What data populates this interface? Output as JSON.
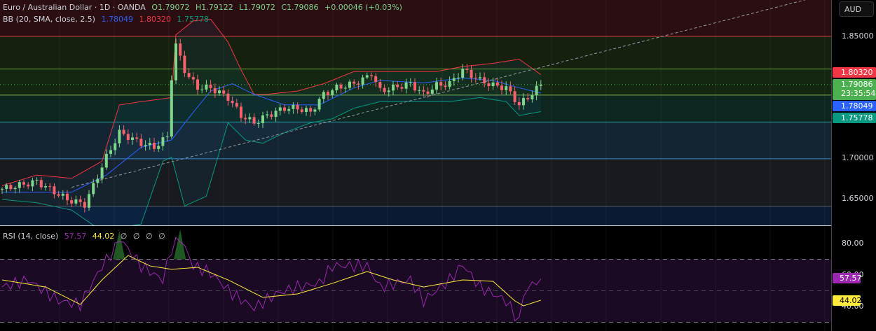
{
  "header": {
    "symbol": "Euro / Australian Dollar · 1D · OANDA",
    "open": "O1.79072",
    "high": "H1.79122",
    "low": "L1.79072",
    "close": "C1.79086",
    "change": "+0.00046 (+0.03%)"
  },
  "bb_legend": {
    "label": "BB (20, SMA, close, 2.5)",
    "basis": "1.78049",
    "upper": "1.80320",
    "lower": "1.75778"
  },
  "rsi_legend": {
    "label": "RSI (14, close)",
    "rsi": "57.57",
    "ma": "44.02",
    "extra": [
      "∅",
      "∅",
      "∅",
      "∅"
    ]
  },
  "axis": {
    "currency": "AUD",
    "price_ticks": [
      "1.85000",
      "1.70000",
      "1.65000"
    ],
    "rsi_ticks": [
      "80.00",
      "60.00",
      "40.00"
    ],
    "tags": {
      "upper": "1.80320",
      "last": "1.79086",
      "countdown": "23:35:54",
      "basis": "1.78049",
      "lower": "1.75778",
      "rsi": "57.57",
      "rsi_ma": "44.02"
    }
  },
  "colors": {
    "up": "#7fd68a",
    "down": "#f7606c",
    "basis": "#2962ff",
    "upper": "#f23645",
    "lower": "#089981",
    "rsi": "#9c27b0",
    "rsi_ma": "#ffeb3b"
  },
  "chart_data": {
    "type": "candlestick",
    "price_range": [
      1.6,
      1.895
    ],
    "levels": [
      1.85,
      1.81,
      1.778,
      1.745,
      1.7,
      1.6415
    ],
    "close_path": [
      [
        0,
        1.663
      ],
      [
        8,
        1.672
      ],
      [
        15,
        1.65
      ],
      [
        19,
        1.644
      ],
      [
        21,
        1.667
      ],
      [
        24,
        1.702
      ],
      [
        27,
        1.732
      ],
      [
        29,
        1.727
      ],
      [
        32,
        1.719
      ],
      [
        35,
        1.714
      ],
      [
        38,
        1.727
      ],
      [
        39,
        1.8
      ],
      [
        40,
        1.839
      ],
      [
        42,
        1.809
      ],
      [
        43,
        1.8
      ],
      [
        45,
        1.787
      ],
      [
        48,
        1.787
      ],
      [
        52,
        1.775
      ],
      [
        55,
        1.753
      ],
      [
        58,
        1.744
      ],
      [
        61,
        1.753
      ],
      [
        65,
        1.762
      ],
      [
        68,
        1.762
      ],
      [
        71,
        1.757
      ],
      [
        74,
        1.779
      ],
      [
        77,
        1.787
      ],
      [
        81,
        1.792
      ],
      [
        84,
        1.8
      ],
      [
        85,
        1.805
      ],
      [
        87,
        1.783
      ],
      [
        90,
        1.787
      ],
      [
        94,
        1.792
      ],
      [
        97,
        1.779
      ],
      [
        100,
        1.79
      ],
      [
        103,
        1.792
      ],
      [
        106,
        1.809
      ],
      [
        110,
        1.796
      ],
      [
        113,
        1.79
      ],
      [
        116,
        1.787
      ],
      [
        119,
        1.766
      ],
      [
        121,
        1.775
      ],
      [
        124,
        1.79086
      ]
    ],
    "bb_upper": [
      [
        0,
        1.667
      ],
      [
        8,
        1.68
      ],
      [
        16,
        1.676
      ],
      [
        23,
        1.697
      ],
      [
        27,
        1.766
      ],
      [
        32,
        1.77
      ],
      [
        39,
        1.775
      ],
      [
        40,
        1.852
      ],
      [
        44,
        1.869
      ],
      [
        48,
        1.871
      ],
      [
        52,
        1.843
      ],
      [
        55,
        1.809
      ],
      [
        58,
        1.779
      ],
      [
        61,
        1.779
      ],
      [
        68,
        1.783
      ],
      [
        74,
        1.792
      ],
      [
        81,
        1.807
      ],
      [
        100,
        1.807
      ],
      [
        106,
        1.813
      ],
      [
        113,
        1.817
      ],
      [
        119,
        1.822
      ],
      [
        124,
        1.8032
      ]
    ],
    "bb_lower": [
      [
        0,
        1.65
      ],
      [
        8,
        1.646
      ],
      [
        16,
        1.637
      ],
      [
        23,
        1.611
      ],
      [
        32,
        1.62
      ],
      [
        37,
        1.697
      ],
      [
        39,
        1.702
      ],
      [
        42,
        1.642
      ],
      [
        47,
        1.654
      ],
      [
        52,
        1.744
      ],
      [
        56,
        1.723
      ],
      [
        60,
        1.719
      ],
      [
        65,
        1.732
      ],
      [
        71,
        1.744
      ],
      [
        76,
        1.749
      ],
      [
        81,
        1.762
      ],
      [
        87,
        1.77
      ],
      [
        103,
        1.77
      ],
      [
        110,
        1.775
      ],
      [
        116,
        1.77
      ],
      [
        119,
        1.753
      ],
      [
        124,
        1.75778
      ]
    ],
    "bb_basis": [
      [
        0,
        1.659
      ],
      [
        16,
        1.659
      ],
      [
        24,
        1.68
      ],
      [
        32,
        1.714
      ],
      [
        39,
        1.723
      ],
      [
        44,
        1.757
      ],
      [
        48,
        1.783
      ],
      [
        53,
        1.792
      ],
      [
        58,
        1.779
      ],
      [
        65,
        1.766
      ],
      [
        73,
        1.766
      ],
      [
        81,
        1.787
      ],
      [
        87,
        1.796
      ],
      [
        97,
        1.793
      ],
      [
        106,
        1.799
      ],
      [
        113,
        1.796
      ],
      [
        119,
        1.787
      ],
      [
        124,
        1.78049
      ]
    ],
    "trendline": [
      [
        16,
        1.665
      ],
      [
        185,
        1.895
      ]
    ],
    "rsi_range": [
      20,
      91
    ],
    "rsi_levels": [
      70,
      50,
      30
    ],
    "rsi": [
      [
        0,
        52.4
      ],
      [
        6,
        56.9
      ],
      [
        13,
        43.6
      ],
      [
        18,
        41.3
      ],
      [
        23,
        65.8
      ],
      [
        26,
        76.9
      ],
      [
        27,
        83.6
      ],
      [
        32,
        65.8
      ],
      [
        37,
        56.9
      ],
      [
        39,
        76.9
      ],
      [
        41,
        83.6
      ],
      [
        44,
        65.8
      ],
      [
        48,
        61.3
      ],
      [
        53,
        48
      ],
      [
        58,
        39.1
      ],
      [
        63,
        48
      ],
      [
        68,
        52.4
      ],
      [
        73,
        54.7
      ],
      [
        76,
        65.8
      ],
      [
        84,
        65.8
      ],
      [
        87,
        52.4
      ],
      [
        94,
        56.9
      ],
      [
        97,
        43.6
      ],
      [
        103,
        56.9
      ],
      [
        106,
        66.7
      ],
      [
        110,
        52.4
      ],
      [
        116,
        43.6
      ],
      [
        119,
        30.2
      ],
      [
        120,
        48
      ],
      [
        123,
        56.9
      ],
      [
        124,
        57.57
      ]
    ],
    "rsi_ma": [
      [
        0,
        56.9
      ],
      [
        10,
        52.4
      ],
      [
        18,
        41.3
      ],
      [
        23,
        56.9
      ],
      [
        29,
        72.4
      ],
      [
        34,
        65.8
      ],
      [
        39,
        63.6
      ],
      [
        45,
        64.9
      ],
      [
        52,
        56.9
      ],
      [
        60,
        45.8
      ],
      [
        68,
        48
      ],
      [
        76,
        54.7
      ],
      [
        84,
        62.2
      ],
      [
        90,
        56.9
      ],
      [
        97,
        52.4
      ],
      [
        106,
        56.9
      ],
      [
        113,
        56
      ],
      [
        118,
        43.6
      ],
      [
        120,
        40.4
      ],
      [
        124,
        44.02
      ]
    ]
  }
}
